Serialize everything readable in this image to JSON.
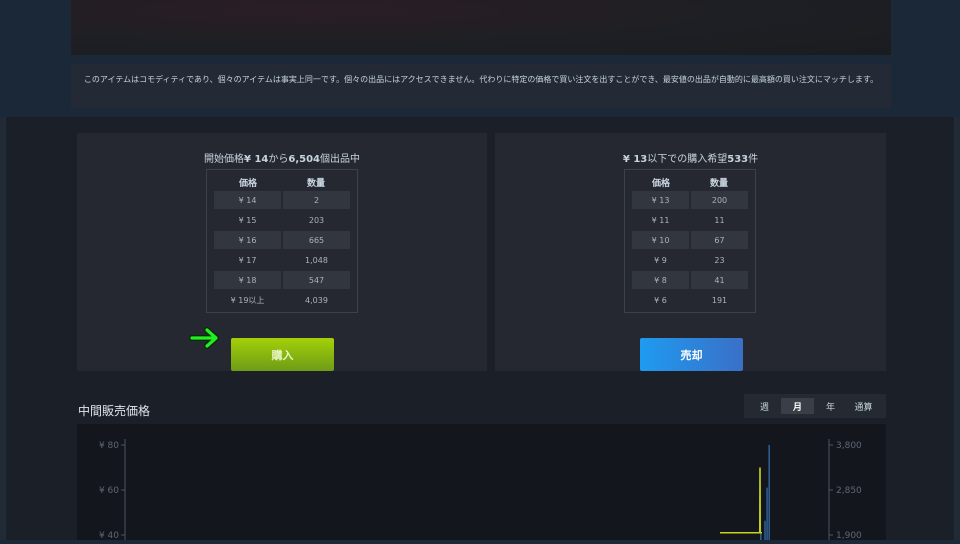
{
  "notice": "このアイテムはコモディティであり、個々のアイテムは事実上同一です。個々の出品にはアクセスできません。代わりに特定の価格で買い注文を出すことができ、最安値の出品が自動的に最高額の買い注文にマッチします。",
  "sell_panel": {
    "title_prefix": "開始価格",
    "start_price": "¥ 14",
    "title_mid": "から",
    "quantity": "6,504",
    "title_suffix": "個出品中",
    "columns": [
      "価格",
      "数量"
    ],
    "rows": [
      {
        "price": "¥ 14",
        "qty": "2"
      },
      {
        "price": "¥ 15",
        "qty": "203"
      },
      {
        "price": "¥ 16",
        "qty": "665"
      },
      {
        "price": "¥ 17",
        "qty": "1,048"
      },
      {
        "price": "¥ 18",
        "qty": "547"
      },
      {
        "price": "¥ 19以上",
        "qty": "4,039"
      }
    ],
    "button_label": "購入"
  },
  "buy_panel": {
    "price": "¥ 13",
    "title_mid": "以下での購入希望",
    "count": "533",
    "title_suffix": "件",
    "columns": [
      "価格",
      "数量"
    ],
    "rows": [
      {
        "price": "¥ 13",
        "qty": "200"
      },
      {
        "price": "¥ 11",
        "qty": "11"
      },
      {
        "price": "¥ 10",
        "qty": "67"
      },
      {
        "price": "¥ 9",
        "qty": "23"
      },
      {
        "price": "¥ 8",
        "qty": "41"
      },
      {
        "price": "¥ 6",
        "qty": "191"
      }
    ],
    "button_label": "売却"
  },
  "chart_section": {
    "title": "中間販売価格",
    "range_tabs": [
      "週",
      "月",
      "年",
      "通算"
    ],
    "active_tab": "月"
  },
  "colors": {
    "arrow": "#22ee22",
    "price_line": "#c8d41a",
    "volume_bars": "#2c5b8e",
    "buy_button": "#8bb51a",
    "sell_button": "#2a86e0"
  },
  "chart_data": {
    "type": "line",
    "title": "",
    "left_axis_ticks": [
      "¥ 80",
      "¥ 60",
      "¥ 40"
    ],
    "right_axis_ticks": [
      "3,800",
      "2,850",
      "1,900"
    ],
    "ylim_left": [
      40,
      80
    ],
    "ylim_right": [
      1900,
      3800
    ],
    "series": [
      {
        "axis": "left",
        "points": [
          [
            0,
            41
          ],
          [
            0.995,
            41
          ],
          [
            1.0,
            70
          ],
          [
            1.005,
            41
          ],
          [
            1.05,
            41
          ]
        ]
      },
      {
        "axis": "right",
        "style": "bars",
        "points": [
          [
            1.06,
            1950
          ],
          [
            1.12,
            2200
          ],
          [
            1.15,
            2900
          ],
          [
            1.18,
            3800
          ]
        ]
      }
    ]
  }
}
